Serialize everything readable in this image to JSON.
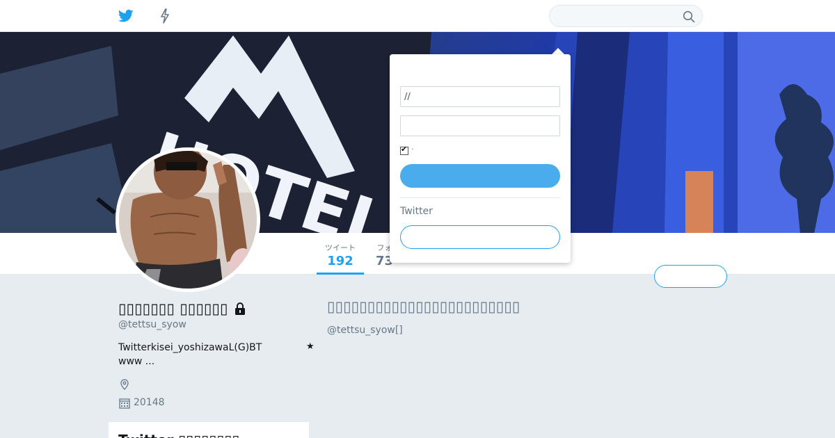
{
  "nav": {
    "logo_icon": "twitter-bird-icon",
    "moments_icon": "lightning-bolt-icon",
    "search": {
      "value": "",
      "placeholder": "",
      "icon": "magnifier-icon"
    }
  },
  "banner": {
    "sign_text": "HOTEL"
  },
  "profile_nav": {
    "stats": [
      {
        "label": "ツイート",
        "value": "192"
      },
      {
        "label": "フォ",
        "value": "73"
      },
      {
        "label": "",
        "value": ""
      },
      {
        "label": "",
        "value": ""
      }
    ],
    "follow_label": ""
  },
  "profile": {
    "name": "▯▯▯▯▯▯▯ ▯▯▯▯▯▯",
    "handle": "@tettsu_syow",
    "bio_line1": "Twitterkisei_yoshizawaL(G)BT",
    "bio_line2": "www ...",
    "star": "★",
    "location_icon": "map-pin-icon",
    "calendar_icon": "calendar-icon",
    "joined": "20148",
    "sidebar_title": "Twitter ▯▯▯▯▯▯▯▯"
  },
  "timeline": {
    "protected_title": "▯▯▯▯▯▯▯▯▯▯▯▯▯▯▯▯▯▯▯▯▯▯▯▯",
    "protected_sub": "@tettsu_syow[]"
  },
  "login": {
    "username_value": "//",
    "password_value": "",
    "remember_label": "·",
    "login_button_label": "",
    "signup_prompt": "Twitter",
    "signup_button_label": ""
  },
  "colors": {
    "accent": "#1da1f2",
    "login_button": "#4aabed",
    "background": "#e6ecf0",
    "muted_text": "#657786"
  }
}
